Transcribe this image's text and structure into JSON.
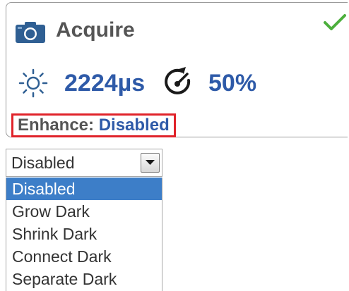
{
  "card": {
    "title": "Acquire",
    "status_icon": "check-icon",
    "exposure": "2224µs",
    "gain": "50%",
    "enhance_label": "Enhance:",
    "enhance_value": "Disabled"
  },
  "colors": {
    "accent_blue": "#2e5aa8",
    "highlight_border": "#e0232a",
    "check_green": "#4caf3c",
    "selected_option_bg": "#3d7ec8"
  },
  "dropdown": {
    "selected": "Disabled",
    "options": [
      {
        "label": "Disabled",
        "selected": true
      },
      {
        "label": "Grow Dark",
        "selected": false
      },
      {
        "label": "Shrink Dark",
        "selected": false
      },
      {
        "label": "Connect Dark",
        "selected": false
      },
      {
        "label": "Separate Dark",
        "selected": false
      }
    ]
  }
}
